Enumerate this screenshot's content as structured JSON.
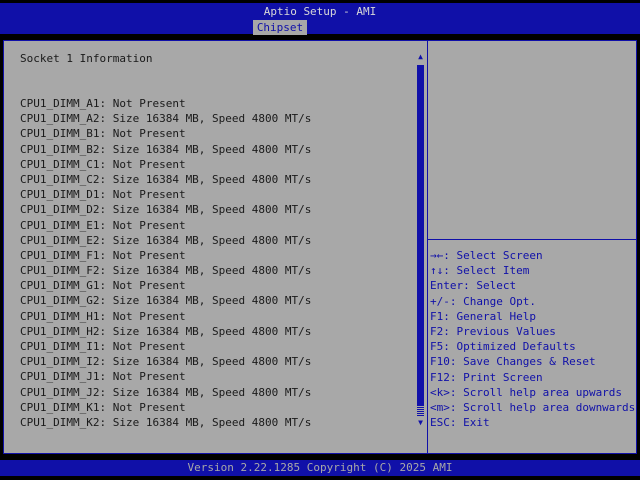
{
  "header": {
    "title": "Aptio Setup - AMI",
    "active_tab": "Chipset"
  },
  "main": {
    "section_title": "Socket 1 Information",
    "dimms": [
      "CPU1_DIMM_A1: Not Present",
      "CPU1_DIMM_A2: Size 16384 MB, Speed 4800 MT/s",
      "CPU1_DIMM_B1: Not Present",
      "CPU1_DIMM_B2: Size 16384 MB, Speed 4800 MT/s",
      "CPU1_DIMM_C1: Not Present",
      "CPU1_DIMM_C2: Size 16384 MB, Speed 4800 MT/s",
      "CPU1_DIMM_D1: Not Present",
      "CPU1_DIMM_D2: Size 16384 MB, Speed 4800 MT/s",
      "CPU1_DIMM_E1: Not Present",
      "CPU1_DIMM_E2: Size 16384 MB, Speed 4800 MT/s",
      "CPU1_DIMM_F1: Not Present",
      "CPU1_DIMM_F2: Size 16384 MB, Speed 4800 MT/s",
      "CPU1_DIMM_G1: Not Present",
      "CPU1_DIMM_G2: Size 16384 MB, Speed 4800 MT/s",
      "CPU1_DIMM_H1: Not Present",
      "CPU1_DIMM_H2: Size 16384 MB, Speed 4800 MT/s",
      "CPU1_DIMM_I1: Not Present",
      "CPU1_DIMM_I2: Size 16384 MB, Speed 4800 MT/s",
      "CPU1_DIMM_J1: Not Present",
      "CPU1_DIMM_J2: Size 16384 MB, Speed 4800 MT/s",
      "CPU1_DIMM_K1: Not Present",
      "CPU1_DIMM_K2: Size 16384 MB, Speed 4800 MT/s"
    ],
    "scrollbar": {
      "up_icon": "▲",
      "down_icon": "▼"
    }
  },
  "help": {
    "keys": [
      "→←: Select Screen",
      "↑↓: Select Item",
      "Enter: Select",
      "+/-: Change Opt.",
      "F1: General Help",
      "F2: Previous Values",
      "F5: Optimized Defaults",
      "F10: Save Changes & Reset",
      "F12: Print Screen",
      "<k>: Scroll help area upwards",
      "<m>: Scroll help area downwards",
      "ESC: Exit"
    ]
  },
  "footer": {
    "text": "Version 2.22.1285 Copyright (C) 2025 AMI"
  },
  "colors": {
    "bios_blue": "#1010a8",
    "panel_gray": "#a8a8a8",
    "text_dark": "#1a1a1a"
  }
}
